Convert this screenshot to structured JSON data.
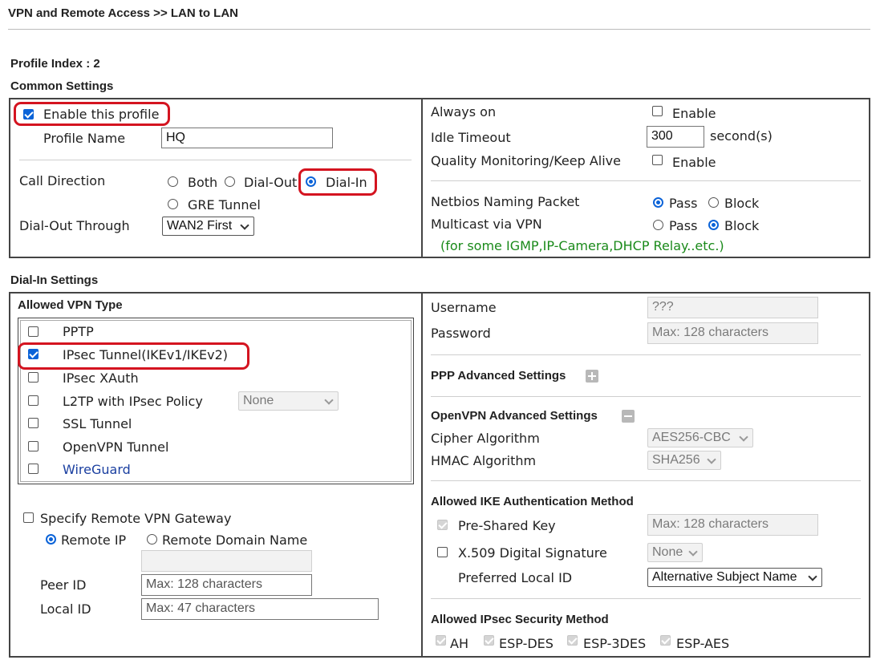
{
  "breadcrumb": "VPN and Remote Access >> LAN to LAN",
  "profile_index": "Profile Index : 2",
  "common": {
    "heading": "Common Settings",
    "enable_label": "Enable this profile",
    "profile_name_label": "Profile Name",
    "profile_name_value": "HQ",
    "call_direction_label": "Call Direction",
    "dir_both": "Both",
    "dir_dialout": "Dial-Out",
    "dir_dialin": "Dial-In",
    "dir_gre": "GRE Tunnel",
    "dialout_through_label": "Dial-Out Through",
    "dialout_through_value": "WAN2 First",
    "always_on_label": "Always on",
    "enable_text": "Enable",
    "idle_timeout_label": "Idle Timeout",
    "idle_timeout_value": "300",
    "seconds_text": "second(s)",
    "quality_label": "Quality Monitoring/Keep Alive",
    "netbios_label": "Netbios Naming Packet",
    "pass_text": "Pass",
    "block_text": "Block",
    "multicast_label": "Multicast via VPN",
    "multicast_note": "(for some IGMP,IP-Camera,DHCP Relay..etc.)"
  },
  "dialin": {
    "heading": "Dial-In Settings",
    "allowed_vpn_heading": "Allowed VPN Type",
    "vpn_pptp": "PPTP",
    "vpn_ipsec": "IPsec Tunnel(IKEv1/IKEv2)",
    "vpn_xauth": "IPsec XAuth",
    "vpn_l2tp": "L2TP with IPsec Policy",
    "l2tp_policy_value": "None",
    "vpn_ssl": "SSL Tunnel",
    "vpn_openvpn": "OpenVPN Tunnel",
    "vpn_wireguard": "WireGuard",
    "specify_gateway_label": "Specify Remote VPN Gateway",
    "remote_ip_label": "Remote IP",
    "remote_domain_label": "Remote Domain Name",
    "peer_id_label": "Peer ID",
    "peer_id_placeholder": "Max: 128 characters",
    "local_id_label": "Local ID",
    "local_id_placeholder": "Max: 47 characters",
    "username_label": "Username",
    "username_value": "???",
    "password_label": "Password",
    "password_placeholder": "Max: 128 characters",
    "ppp_adv_heading": "PPP Advanced Settings",
    "openvpn_adv_heading": "OpenVPN Advanced Settings",
    "cipher_label": "Cipher Algorithm",
    "cipher_value": "AES256-CBC",
    "hmac_label": "HMAC Algorithm",
    "hmac_value": "SHA256",
    "ike_heading": "Allowed IKE Authentication Method",
    "psk_label": "Pre-Shared Key",
    "psk_placeholder": "Max: 128 characters",
    "x509_label": "X.509 Digital Signature",
    "x509_value": "None",
    "pref_local_id_label": "Preferred Local ID",
    "pref_local_id_value": "Alternative Subject Name",
    "ipsec_heading": "Allowed IPsec Security Method",
    "ah": "AH",
    "esp_des": "ESP-DES",
    "esp_3des": "ESP-3DES",
    "esp_aes": "ESP-AES"
  },
  "colors": {
    "highlight": "#d41420",
    "accent": "#0b63d8",
    "note": "#1a8a1a",
    "link": "#1a3fa0"
  }
}
